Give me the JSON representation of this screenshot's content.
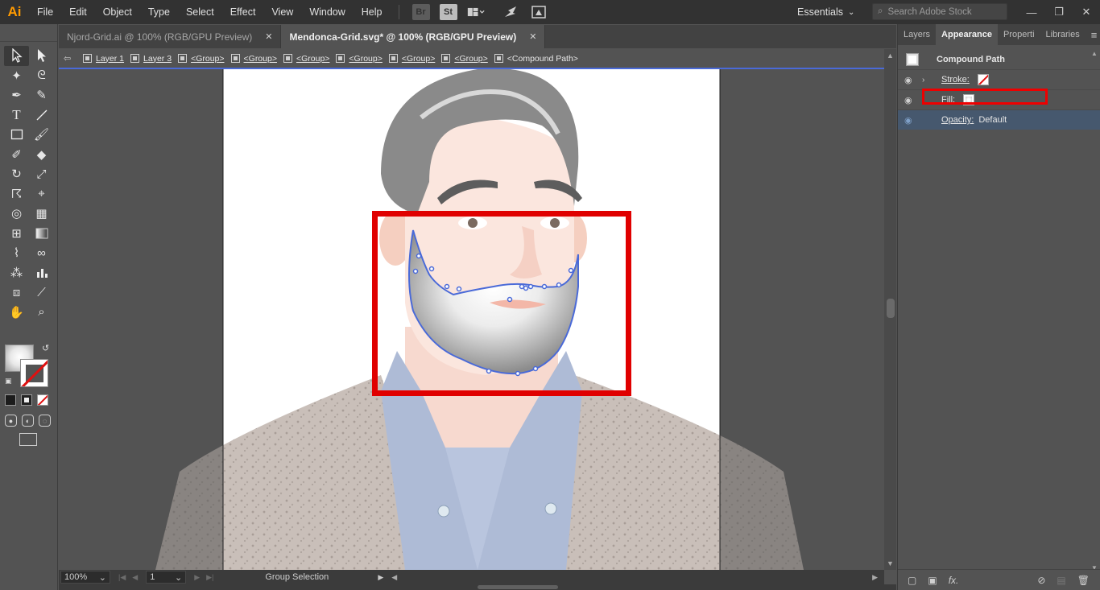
{
  "app": {
    "logo": "Ai"
  },
  "menu": [
    "File",
    "Edit",
    "Object",
    "Type",
    "Select",
    "Effect",
    "View",
    "Window",
    "Help"
  ],
  "menubar_buttons": {
    "bridge": "Br",
    "stock": "St"
  },
  "workspace": {
    "label": "Essentials"
  },
  "stock_search": {
    "placeholder": "Search Adobe Stock"
  },
  "tabs": [
    {
      "label": "Njord-Grid.ai @ 100% (RGB/GPU Preview)",
      "close": "✕"
    },
    {
      "label": "Mendonca-Grid.svg* @ 100% (RGB/GPU Preview)",
      "close": "✕"
    }
  ],
  "breadcrumb": [
    "Layer 1",
    "Layer 3",
    "<Group>",
    "<Group>",
    "<Group>",
    "<Group>",
    "<Group>",
    "<Group>",
    "<Compound Path>"
  ],
  "status": {
    "zoom": "100%",
    "page": "1",
    "tool": "Group Selection"
  },
  "panel": {
    "tabs": [
      "Layers",
      "Appearance",
      "Properti",
      "Libraries"
    ],
    "menu_icon": "≡",
    "title": "Compound Path",
    "rows": [
      {
        "label": "Stroke:",
        "swatch": "none"
      },
      {
        "label": "Fill:",
        "swatch": "radial-gradient"
      },
      {
        "label": "Opacity:",
        "value": "Default"
      }
    ],
    "bottom_icons": [
      "new-art-icon",
      "clear-icon",
      "fx-icon",
      "delete-icon"
    ],
    "fx_label": "fx."
  },
  "colors": {
    "highlight_red": "#e00000",
    "selection_blue": "#4a6ad8",
    "panel_bg": "#535353",
    "menubar_bg": "#323232"
  }
}
